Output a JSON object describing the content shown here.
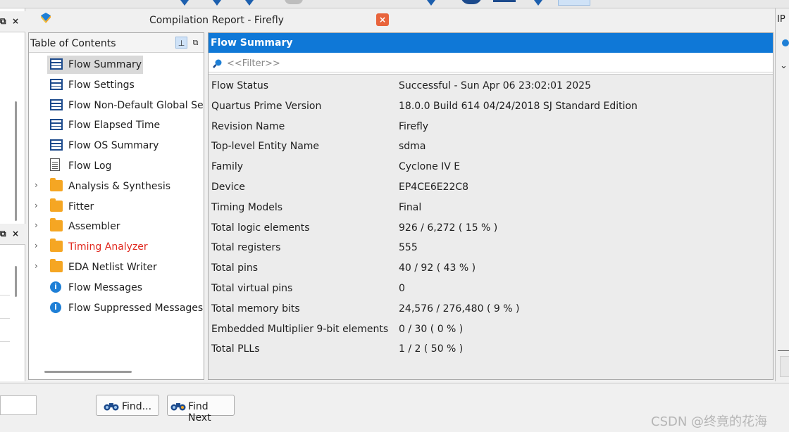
{
  "window": {
    "title": "Compilation Report - Firefly",
    "close_glyph": "×"
  },
  "toc": {
    "header": "Table of Contents",
    "items": [
      {
        "label": "Flow Summary",
        "icon": "table-icon",
        "selected": true
      },
      {
        "label": "Flow Settings",
        "icon": "table-icon"
      },
      {
        "label": "Flow Non-Default Global Settings",
        "icon": "table-icon"
      },
      {
        "label": "Flow Elapsed Time",
        "icon": "table-icon"
      },
      {
        "label": "Flow OS Summary",
        "icon": "table-icon"
      },
      {
        "label": "Flow Log",
        "icon": "log-icon"
      },
      {
        "label": "Analysis & Synthesis",
        "icon": "folder-icon",
        "expandable": true
      },
      {
        "label": "Fitter",
        "icon": "folder-icon",
        "expandable": true
      },
      {
        "label": "Assembler",
        "icon": "folder-icon",
        "expandable": true
      },
      {
        "label": "Timing Analyzer",
        "icon": "folder-icon",
        "expandable": true,
        "color": "#e0281e"
      },
      {
        "label": "EDA Netlist Writer",
        "icon": "folder-icon",
        "expandable": true
      },
      {
        "label": "Flow Messages",
        "icon": "info-icon"
      },
      {
        "label": "Flow Suppressed Messages",
        "icon": "info-icon"
      }
    ]
  },
  "summary": {
    "header": "Flow Summary",
    "filter_placeholder": "<<Filter>>",
    "rows": [
      {
        "key": "Flow Status",
        "value": "Successful - Sun Apr 06 23:02:01 2025"
      },
      {
        "key": "Quartus Prime Version",
        "value": "18.0.0 Build 614 04/24/2018 SJ Standard Edition"
      },
      {
        "key": "Revision Name",
        "value": "Firefly"
      },
      {
        "key": "Top-level Entity Name",
        "value": "sdma"
      },
      {
        "key": "Family",
        "value": "Cyclone IV E"
      },
      {
        "key": "Device",
        "value": "EP4CE6E22C8"
      },
      {
        "key": "Timing Models",
        "value": "Final"
      },
      {
        "key": "Total logic elements",
        "value": "926 / 6,272 ( 15 % )"
      },
      {
        "key": "Total registers",
        "value": "555"
      },
      {
        "key": "Total pins",
        "value": "40 / 92 ( 43 % )"
      },
      {
        "key": "Total virtual pins",
        "value": "0"
      },
      {
        "key": "Total memory bits",
        "value": "24,576 / 276,480 ( 9 % )"
      },
      {
        "key": "Embedded Multiplier 9-bit elements",
        "value": "0 / 30 ( 0 % )"
      },
      {
        "key": "Total PLLs",
        "value": "1 / 2 ( 50 % )"
      }
    ]
  },
  "right_dock": {
    "label": "IP"
  },
  "bottom": {
    "find_label": "Find...",
    "find_next_label": "Find Next"
  },
  "watermark": "CSDN @终竟的花海",
  "colors": {
    "accent": "#0f78d7",
    "error": "#e0281e",
    "folder": "#f5a623"
  }
}
